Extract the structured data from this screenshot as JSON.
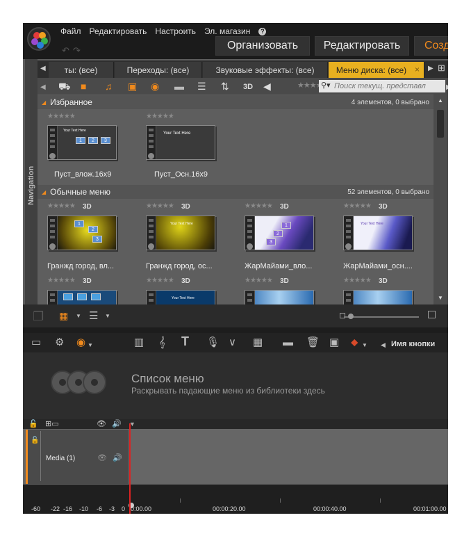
{
  "menu": {
    "items": [
      "Файл",
      "Редактировать",
      "Настроить",
      "Эл. магазин"
    ],
    "help": "?"
  },
  "modes": {
    "organize": "Организовать",
    "edit": "Редактировать",
    "create": "Созд"
  },
  "tabs": [
    {
      "label": "ты: (все)",
      "active": false
    },
    {
      "label": "Переходы: (все)",
      "active": false
    },
    {
      "label": "Звуковые эффекты: (все)",
      "active": false
    },
    {
      "label": "Меню диска: (все)",
      "active": true
    }
  ],
  "navigation_label": "Navigation",
  "toolbar": {
    "badge_3d": "3D",
    "search_placeholder": "Поиск текущ. представл"
  },
  "favorites": {
    "title": "Избранное",
    "count": "4 элементов, 0 выбрано",
    "items": [
      {
        "name": "Пуст_влож.16x9",
        "thumb_text": "Your Text Here",
        "button_labels": [
          "1",
          "2",
          "3"
        ],
        "has_3d": false
      },
      {
        "name": "Пуст_Осн.16x9",
        "thumb_text": "Your Text Here",
        "has_3d": false
      }
    ]
  },
  "regular_menus": {
    "title": "Обычные меню",
    "count": "52 элементов, 0 выбрано",
    "items": [
      {
        "name": "Гранжд город, вл...",
        "thumb_text": "",
        "button_labels": [
          "1",
          "2",
          "3"
        ],
        "has_3d": true
      },
      {
        "name": "Гранжд город, ос...",
        "thumb_text": "Your Text Here",
        "has_3d": true
      },
      {
        "name": "ЖарМайами_вло...",
        "thumb_text": "",
        "button_labels": [
          "1",
          "2",
          "3"
        ],
        "has_3d": true
      },
      {
        "name": "ЖарМайами_осн....",
        "thumb_text": "Your Text Here",
        "has_3d": true
      }
    ],
    "row2_3d": true
  },
  "editor_toolbar": {
    "button_name_label": "Имя кнопки"
  },
  "menu_list": {
    "title": "Список меню",
    "subtitle": "Раскрывать падающие меню из библиотеки здесь"
  },
  "track": {
    "name": "Media (1)"
  },
  "ruler": {
    "levels": [
      "-60",
      "-22",
      "-16",
      "-10",
      "-6",
      "-3",
      "0"
    ],
    "times": [
      "0:00.00",
      "00:00:20.00",
      "00:00:40.00",
      "00:01:00.00"
    ]
  },
  "colors": {
    "accent": "#f08a1d",
    "active_tab": "#e8b020",
    "playhead": "#dd2222"
  }
}
